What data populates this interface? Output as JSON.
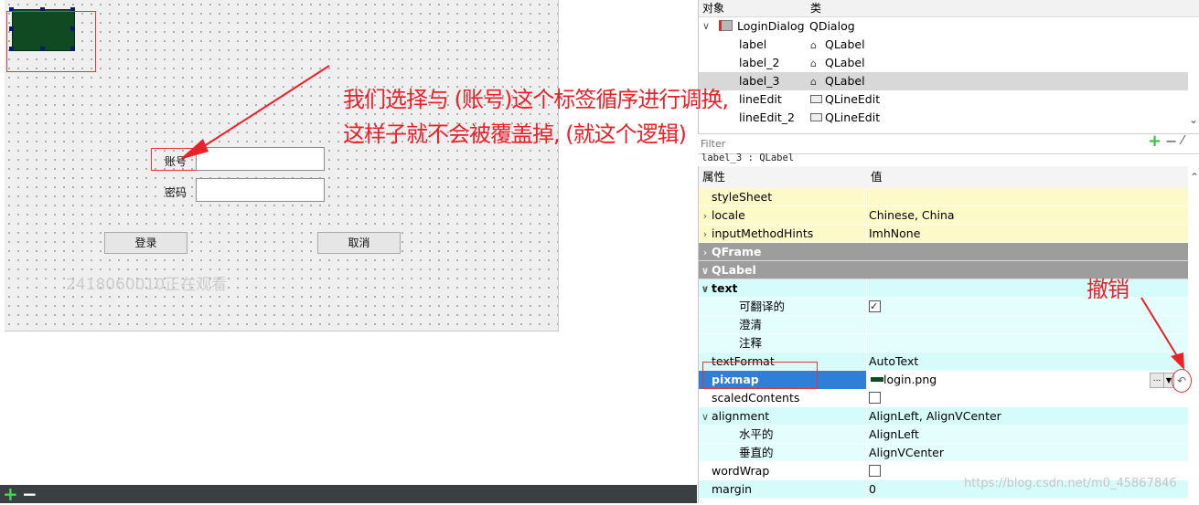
{
  "form": {
    "account_label": "账号",
    "password_label": "密码",
    "account_value": "",
    "password_value": "",
    "login_button": "登录",
    "cancel_button": "取消",
    "viewer_watermark": "2418060010正在观看"
  },
  "annotations": {
    "line1": "我们选择与 (账号)这个标签循序进行调换,",
    "line2": "这样子就不会被覆盖掉, (就这个逻辑)",
    "undo_label": "撤销"
  },
  "object_inspector": {
    "col_object": "对象",
    "col_class": "类",
    "rows": [
      {
        "name": "LoginDialog",
        "class": "QDialog",
        "selected": false
      },
      {
        "name": "label",
        "class": "QLabel",
        "selected": false
      },
      {
        "name": "label_2",
        "class": "QLabel",
        "selected": false
      },
      {
        "name": "label_3",
        "class": "QLabel",
        "selected": true
      },
      {
        "name": "lineEdit",
        "class": "QLineEdit",
        "selected": false
      },
      {
        "name": "lineEdit_2",
        "class": "QLineEdit",
        "selected": false
      }
    ]
  },
  "filter": {
    "placeholder": "Filter"
  },
  "property_editor": {
    "caption": "label_3 : QLabel",
    "col_property": "属性",
    "col_value": "值",
    "rows": [
      {
        "name": "styleSheet",
        "value": ""
      },
      {
        "name": "locale",
        "value": "Chinese, China"
      },
      {
        "name": "inputMethodHints",
        "value": "ImhNone"
      },
      {
        "name": "QFrame",
        "value": ""
      },
      {
        "name": "QLabel",
        "value": ""
      },
      {
        "name": "text",
        "value": ""
      },
      {
        "name": "可翻译的",
        "value": ""
      },
      {
        "name": "澄清",
        "value": ""
      },
      {
        "name": "注释",
        "value": ""
      },
      {
        "name": "textFormat",
        "value": "AutoText"
      },
      {
        "name": "pixmap",
        "value": "login.png"
      },
      {
        "name": "scaledContents",
        "value": ""
      },
      {
        "name": "alignment",
        "value": "AlignLeft, AlignVCenter"
      },
      {
        "name": "水平的",
        "value": "AlignLeft"
      },
      {
        "name": "垂直的",
        "value": "AlignVCenter"
      },
      {
        "name": "wordWrap",
        "value": ""
      },
      {
        "name": "margin",
        "value": "0"
      }
    ],
    "translatable_checked": true,
    "scaled_contents_checked": false,
    "word_wrap_checked": false,
    "pixmap_browse": "..."
  },
  "watermark": "https://blog.csdn.net/m0_45867846",
  "colors": {
    "annotation_red": "#ec2029",
    "selection_blue": "#2f7fd8",
    "inspector_yellow": "#fef9c8",
    "inspector_cyan": "#d6fbfb",
    "inspector_gray": "#9d9d9d"
  }
}
